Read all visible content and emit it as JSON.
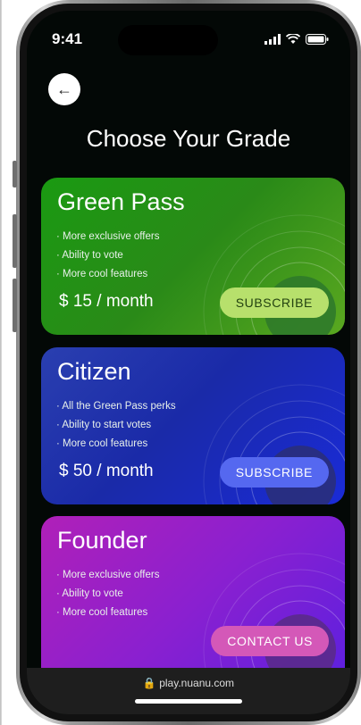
{
  "status": {
    "time": "9:41"
  },
  "header": {
    "title": "Choose Your Grade"
  },
  "plans": [
    {
      "name": "Green Pass",
      "features": [
        "· More exclusive offers",
        "· Ability to vote",
        "· More cool features"
      ],
      "price": "$ 15 / month",
      "cta": "SUBSCRIBE"
    },
    {
      "name": "Citizen",
      "features": [
        "· All the Green Pass perks",
        "· Ability to start votes",
        "· More cool features"
      ],
      "price": "$ 50 / month",
      "cta": "SUBSCRIBE"
    },
    {
      "name": "Founder",
      "features": [
        "· More exclusive offers",
        "· Ability to vote",
        "· More cool features"
      ],
      "cta": "CONTACT US"
    }
  ],
  "browser": {
    "url": "play.nuanu.com"
  },
  "icons": [
    "back-arrow-icon",
    "signal-icon",
    "wifi-icon",
    "battery-icon",
    "lock-icon"
  ]
}
